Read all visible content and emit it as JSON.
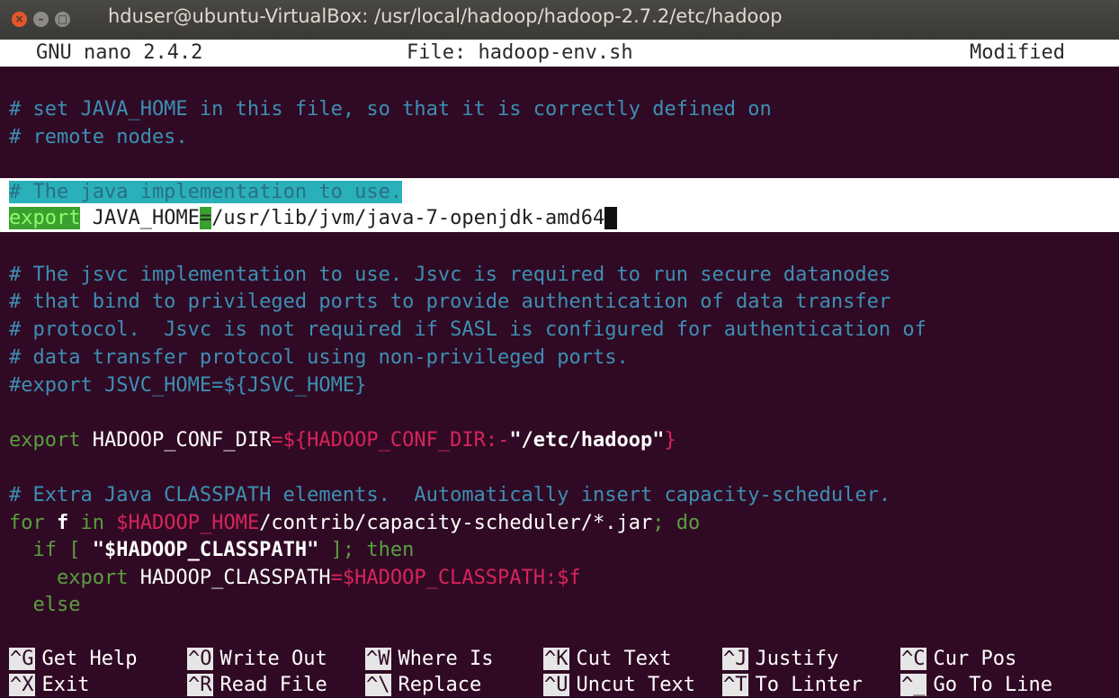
{
  "window": {
    "title": "hduser@ubuntu-VirtualBox: /usr/local/hadoop/hadoop-2.7.2/etc/hadoop",
    "close": "×",
    "minimize": "–",
    "maximize": "□"
  },
  "nano": {
    "version": "GNU nano 2.4.2",
    "file": "File: hadoop-env.sh",
    "status": "Modified"
  },
  "editor": {
    "l1": "# set JAVA_HOME in this file, so that it is correctly defined on",
    "l2": "# remote nodes.",
    "l3": "# The java implementation to use.",
    "l4_a": "export",
    "l4_b": " JAVA_HOME",
    "l4_c": "=",
    "l4_d": "/usr/lib/jvm/java-7-openjdk-amd64",
    "l5": "# The jsvc implementation to use. Jsvc is required to run secure datanodes",
    "l6": "# that bind to privileged ports to provide authentication of data transfer",
    "l7": "# protocol.  Jsvc is not required if SASL is configured for authentication of",
    "l8": "# data transfer protocol using non-privileged ports.",
    "l9": "#export JSVC_HOME=${JSVC_HOME}",
    "l10_a": "export",
    "l10_b": " HADOOP_CONF_DIR",
    "l10_c": "=${HADOOP_CONF_DIR:-",
    "l10_d": "\"/etc/hadoop\"",
    "l10_e": "}",
    "l11": "# Extra Java CLASSPATH elements.  Automatically insert capacity-scheduler.",
    "l12_a": "for",
    "l12_b": " f ",
    "l12_c": "in",
    "l12_d": " $HADOOP_HOME",
    "l12_e": "/contrib/capacity-scheduler/*.jar",
    "l12_f": "; do",
    "l13_a": "  if [ ",
    "l13_b": "\"$HADOOP_CLASSPATH\"",
    "l13_c": " ]; then",
    "l14_a": "    export",
    "l14_b": " HADOOP_CLASSPATH",
    "l14_c": "=$HADOOP_CLASSPATH:$f",
    "l15": "  else"
  },
  "shortcuts": [
    {
      "key": "^G",
      "label": "Get Help"
    },
    {
      "key": "^O",
      "label": "Write Out"
    },
    {
      "key": "^W",
      "label": "Where Is"
    },
    {
      "key": "^K",
      "label": "Cut Text"
    },
    {
      "key": "^J",
      "label": "Justify"
    },
    {
      "key": "^C",
      "label": "Cur Pos"
    },
    {
      "key": "^X",
      "label": "Exit"
    },
    {
      "key": "^R",
      "label": "Read File"
    },
    {
      "key": "^\\",
      "label": "Replace"
    },
    {
      "key": "^U",
      "label": "Uncut Text"
    },
    {
      "key": "^T",
      "label": "To Linter"
    },
    {
      "key": "^_",
      "label": "Go To Line"
    }
  ],
  "colors": {
    "background": "#300a24",
    "comment": "#3d8fb4",
    "keyword": "#5a9e3f",
    "variable": "#d8245a",
    "string": "#ffffff"
  }
}
